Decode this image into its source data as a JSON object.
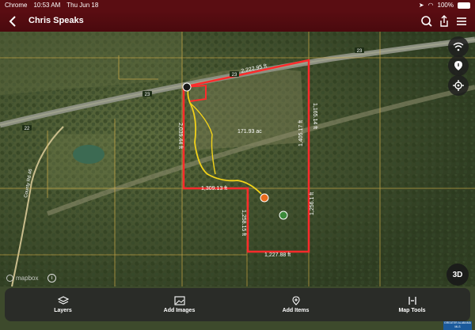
{
  "status_bar": {
    "app": "Chrome",
    "time": "10:53 AM",
    "date": "Thu Jun 18",
    "battery": "100%"
  },
  "header": {
    "title": "Chris Speaks"
  },
  "map": {
    "roads": {
      "hwy_1": "23",
      "hwy_2": "23",
      "hwy_3": "22",
      "hwy_4": "23",
      "county_road": "County Rd 46"
    },
    "parcel": {
      "area": "171.93 ac",
      "edges": {
        "top": "2,222.95 ft",
        "right_top": "1,165.14 ft",
        "right_mid": "1,405.17 ft",
        "left": "2,039.44 ft",
        "middle_h": "1,309.13 ft",
        "inner_v": "1,258.15 ft",
        "right_bottom": "1,256.1 ft",
        "bottom": "1,227.88 ft"
      }
    },
    "attribution": "mapbox"
  },
  "controls": {
    "three_d": "3D"
  },
  "toolbar": {
    "layers": "Layers",
    "add_images": "Add Images",
    "add_items": "Add Items",
    "map_tools": "Map Tools"
  },
  "watermark": "Greater Alabama MLS",
  "colors": {
    "header": "#5a0d12",
    "parcel_outline": "#ff2b2b",
    "trail": "#f2d21a",
    "grid_lines": "#d9b14a"
  }
}
